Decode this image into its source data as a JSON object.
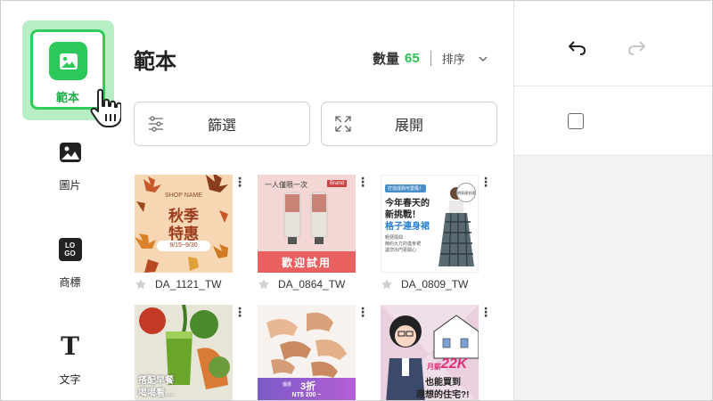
{
  "sidebar": {
    "items": [
      {
        "label": "範本",
        "icon": "image-icon",
        "active": true
      },
      {
        "label": "圖片",
        "icon": "photo-icon"
      },
      {
        "label": "商標",
        "icon": "logo-icon"
      },
      {
        "label": "文字",
        "icon": "text-icon"
      }
    ],
    "logo_icon_text": [
      "LO",
      "GO"
    ],
    "text_icon_glyph": "T"
  },
  "panel": {
    "title": "範本",
    "count_label": "數量",
    "count_value": "65",
    "sort_label": "排序",
    "filter_label": "篩選",
    "expand_label": "展開"
  },
  "templates": [
    {
      "name": "DA_1121_TW",
      "bg": "#f6d6b3",
      "text": {
        "shop": "SHOP NAME",
        "line1": "秋季",
        "line2": "特惠",
        "dates": "9/15~9/30"
      }
    },
    {
      "name": "DA_0864_TW",
      "bg": "#f4d7d4",
      "text": {
        "top": "一人僅限一次",
        "brand": "Brand",
        "cta": "歡迎試用"
      }
    },
    {
      "name": "DA_0809_TW",
      "bg": "#ffffff",
      "text": {
        "tag": "打造成熟可愛風！",
        "l1": "今年春天的",
        "l2": "新挑戰！",
        "l3": "格子連身裙",
        "d1": "輕便隨興",
        "d2": "簡約大方的連身裙",
        "d3": "讓您出門更開心",
        "badge": "明亮連衣裙"
      }
    },
    {
      "name": "",
      "bg": "#f0efe8",
      "text": {
        "l1": "搭配早餐",
        "l2": "喝喝看…"
      }
    },
    {
      "name": "",
      "bg": "#f7f2ee",
      "text": {
        "small": "優惠",
        "discount": "3折",
        "price": "NT$ 200 ~"
      }
    },
    {
      "name": "",
      "bg": "#f1e2ee",
      "text": {
        "l1": "月薪",
        "amount": "22K",
        "l2": "也能買到",
        "l3": "理想的住宅?!"
      }
    }
  ],
  "colors": {
    "accent": "#2cc95a",
    "accent_light": "#b8eec6"
  }
}
